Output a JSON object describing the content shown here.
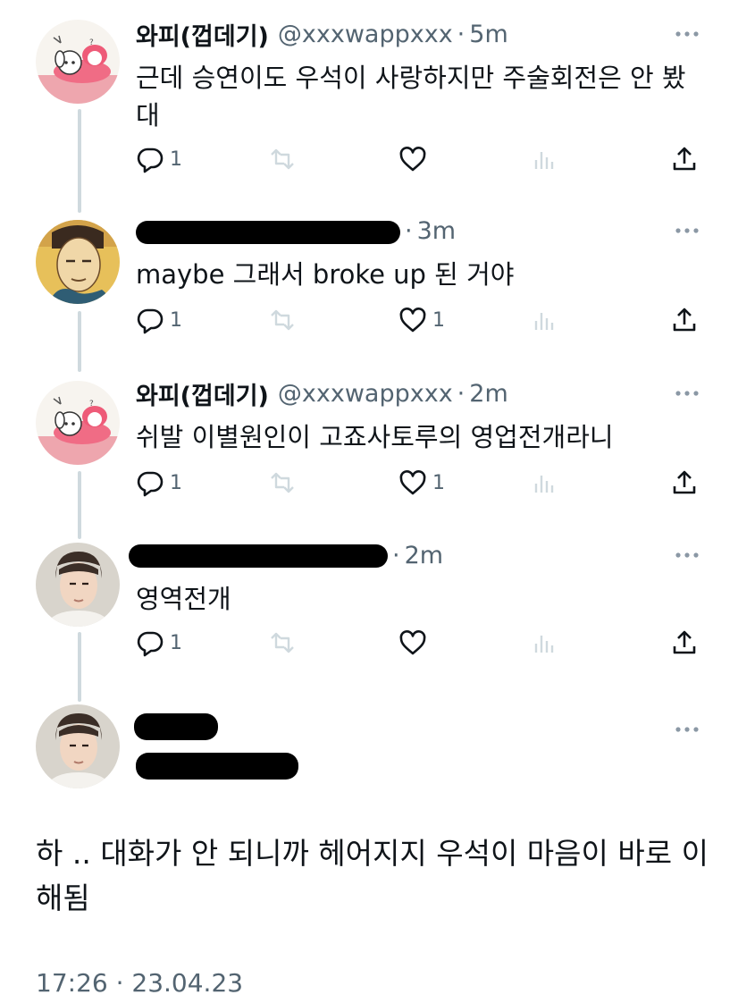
{
  "tweets": [
    {
      "display_name": "와피(껍데기)",
      "handle": "@xxxwappxxx",
      "separator": "·",
      "time": "5m",
      "text": "근데 승연이도 우석이 사랑하지만 주술회전은 안 봤대",
      "reply_count": "1",
      "like_count": ""
    },
    {
      "display_name": "",
      "handle": "",
      "separator": "·",
      "time": "3m",
      "text": "maybe 그래서 broke up 된 거야",
      "reply_count": "1",
      "like_count": "1"
    },
    {
      "display_name": "와피(껍데기)",
      "handle": "@xxxwappxxx",
      "separator": "·",
      "time": "2m",
      "text": "쉬발 이별원인이 고죠사토루의 영업전개라니",
      "reply_count": "1",
      "like_count": "1"
    },
    {
      "display_name": "",
      "handle": "",
      "separator": "·",
      "time": "2m",
      "text": "영역전개",
      "reply_count": "1",
      "like_count": ""
    }
  ],
  "main_tweet": {
    "text": "하 .. 대화가 안 되니까 헤어지지 우석이 마음이 바로 이해됨",
    "timestamp": "17:26 · 23.04.23"
  },
  "icons": {
    "reply": "reply-icon",
    "retweet": "retweet-icon",
    "like": "heart-icon",
    "views": "views-icon",
    "share": "share-icon",
    "more": "more-icon"
  },
  "colors": {
    "text": "#0f1419",
    "secondary": "#536471",
    "thread_line": "#cfd9de"
  }
}
